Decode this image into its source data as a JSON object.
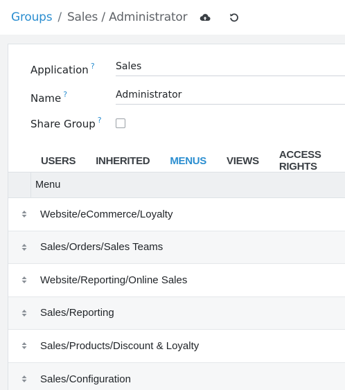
{
  "breadcrumb": {
    "root": "Groups",
    "separator": "/",
    "current": "Sales / Administrator"
  },
  "icons": {
    "save": "cloud-upload-icon",
    "discard": "undo-icon"
  },
  "form": {
    "application": {
      "label": "Application",
      "tooltip": "?",
      "value": "Sales"
    },
    "name": {
      "label": "Name",
      "tooltip": "?",
      "value": "Administrator"
    },
    "share_group": {
      "label": "Share Group",
      "tooltip": "?",
      "checked": false
    }
  },
  "tabs": [
    {
      "label": "USERS",
      "active": false
    },
    {
      "label": "INHERITED",
      "active": false
    },
    {
      "label": "MENUS",
      "active": true
    },
    {
      "label": "VIEWS",
      "active": false
    },
    {
      "label": "ACCESS RIGHTS",
      "active": false
    }
  ],
  "menus_table": {
    "header": "Menu",
    "rows": [
      "Website/eCommerce/Loyalty",
      "Sales/Orders/Sales Teams",
      "Website/Reporting/Online Sales",
      "Sales/Reporting",
      "Sales/Products/Discount & Loyalty",
      "Sales/Configuration"
    ]
  },
  "colors": {
    "accent": "#2b8ed0",
    "text": "#212529",
    "muted": "#5f6368",
    "background": "#f2f3f4"
  }
}
